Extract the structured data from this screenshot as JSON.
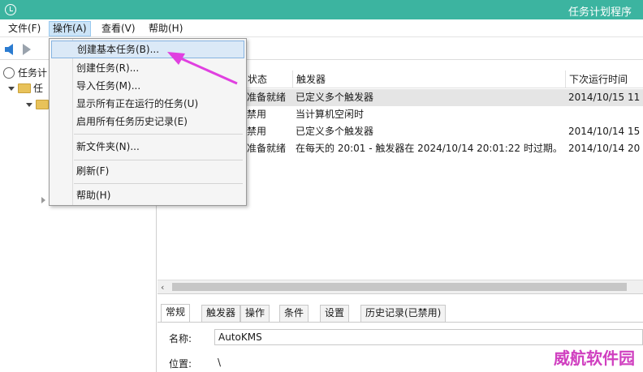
{
  "window": {
    "title": "任务计划程序"
  },
  "menubar": {
    "items": [
      {
        "label": "文件(F)"
      },
      {
        "label": "操作(A)"
      },
      {
        "label": "查看(V)"
      },
      {
        "label": "帮助(H)"
      }
    ]
  },
  "tree": {
    "root_label": "任务计",
    "child_label": "任"
  },
  "grid": {
    "columns": [
      "状态",
      "触发器",
      "下次运行时间"
    ],
    "rows": [
      {
        "status": "准备就绪",
        "trigger": "已定义多个触发器",
        "next_run": "2014/10/15 11"
      },
      {
        "status": "禁用",
        "trigger": "当计算机空闲时",
        "next_run": ""
      },
      {
        "status": "禁用",
        "trigger": "已定义多个触发器",
        "next_run": "2014/10/14 15"
      },
      {
        "status": "准备就绪",
        "trigger": "在每天的 20:01 - 触发器在 2024/10/14 20:01:22 时过期。",
        "next_run": "2014/10/14 20"
      }
    ]
  },
  "dropdown": {
    "items": [
      "创建基本任务(B)...",
      "创建任务(R)...",
      "导入任务(M)...",
      "显示所有正在运行的任务(U)",
      "启用所有任务历史记录(E)",
      "新文件夹(N)...",
      "刷新(F)",
      "帮助(H)"
    ]
  },
  "details": {
    "tabs": [
      "常规",
      "触发器",
      "操作",
      "条件",
      "设置",
      "历史记录(已禁用)"
    ],
    "name_label": "名称:",
    "name_value": "AutoKMS",
    "location_label": "位置:",
    "location_value": "\\"
  },
  "watermark": "威航软件园",
  "colors": {
    "titlebar": "#3cb4a0",
    "highlight": "#dbe9f7",
    "arrow": "#e040e0"
  }
}
